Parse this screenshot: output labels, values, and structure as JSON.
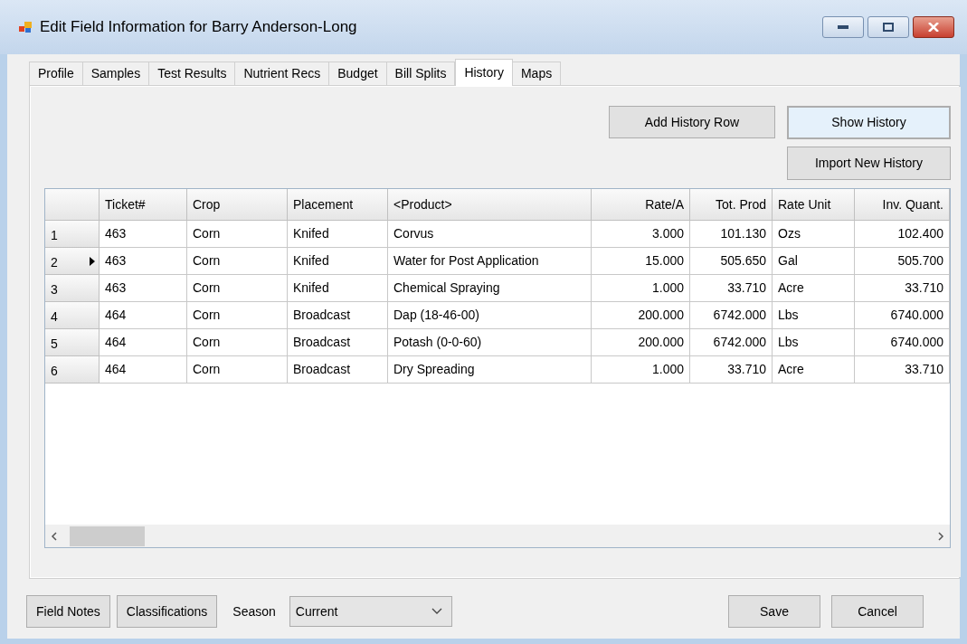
{
  "window": {
    "title": "Edit Field Information for Barry Anderson-Long"
  },
  "tabs": [
    {
      "label": "Profile",
      "selected": false
    },
    {
      "label": "Samples",
      "selected": false
    },
    {
      "label": "Test Results",
      "selected": false
    },
    {
      "label": "Nutrient Recs",
      "selected": false
    },
    {
      "label": "Budget",
      "selected": false
    },
    {
      "label": "Bill Splits",
      "selected": false
    },
    {
      "label": "History",
      "selected": true
    },
    {
      "label": "Maps",
      "selected": false
    }
  ],
  "actions": [
    {
      "label": "Add History Row",
      "focused": false
    },
    {
      "label": "Show History",
      "focused": true
    },
    {
      "label": "Import New History",
      "focused": false
    }
  ],
  "table": {
    "columns": [
      {
        "label": "Ticket#",
        "kind": "text"
      },
      {
        "label": "Crop",
        "kind": "text"
      },
      {
        "label": "Placement",
        "kind": "text"
      },
      {
        "label": "<Product>",
        "kind": "text"
      },
      {
        "label": "Rate/A",
        "kind": "numeric"
      },
      {
        "label": "Tot. Prod",
        "kind": "numeric"
      },
      {
        "label": "Rate Unit",
        "kind": "text"
      },
      {
        "label": "Inv. Quant.",
        "kind": "numeric"
      }
    ],
    "rows": [
      {
        "number": "1",
        "selected": false,
        "cells": [
          "463",
          "Corn",
          "Knifed",
          "Corvus",
          "3.000",
          "101.130",
          "Ozs",
          "102.400"
        ]
      },
      {
        "number": "2",
        "selected": true,
        "cells": [
          "463",
          "Corn",
          "Knifed",
          "Water for Post Application",
          "15.000",
          "505.650",
          "Gal",
          "505.700"
        ]
      },
      {
        "number": "3",
        "selected": false,
        "cells": [
          "463",
          "Corn",
          "Knifed",
          "Chemical Spraying",
          "1.000",
          "33.710",
          "Acre",
          "33.710"
        ]
      },
      {
        "number": "4",
        "selected": false,
        "cells": [
          "464",
          "Corn",
          "Broadcast",
          "Dap (18-46-00)",
          "200.000",
          "6742.000",
          "Lbs",
          "6740.000"
        ]
      },
      {
        "number": "5",
        "selected": false,
        "cells": [
          "464",
          "Corn",
          "Broadcast",
          "Potash (0-0-60)",
          "200.000",
          "6742.000",
          "Lbs",
          "6740.000"
        ]
      },
      {
        "number": "6",
        "selected": false,
        "cells": [
          "464",
          "Corn",
          "Broadcast",
          "Dry Spreading",
          "1.000",
          "33.710",
          "Acre",
          "33.710"
        ]
      }
    ]
  },
  "footer": {
    "left_buttons": [
      "Field Notes",
      "Classifications"
    ],
    "season_label": "Season",
    "season_value": "Current",
    "right_buttons": [
      "Save",
      "Cancel"
    ]
  }
}
